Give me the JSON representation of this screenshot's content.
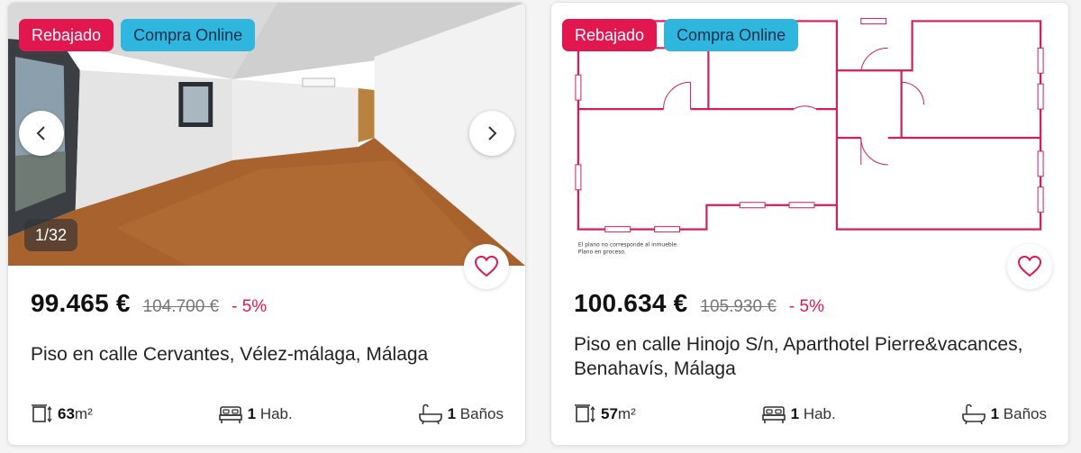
{
  "colors": {
    "accent": "#e3174f",
    "online": "#2fb6df"
  },
  "listings": [
    {
      "badges": {
        "discount_badge": "Rebajado",
        "online_badge": "Compra Online"
      },
      "gallery": {
        "counter": "1/32"
      },
      "price": "99.465 €",
      "old_price": "104.700 €",
      "discount": "- 5%",
      "title": "Piso en calle Cervantes, Vélez-málaga, Málaga",
      "features": {
        "area_value": "63",
        "area_unit": "m²",
        "rooms_value": "1",
        "rooms_label": "Hab.",
        "baths_value": "1",
        "baths_label": "Baños"
      },
      "icons": [
        "chevron-left-icon",
        "chevron-right-icon",
        "heart-icon",
        "area-icon",
        "bed-icon",
        "bathtub-icon"
      ]
    },
    {
      "badges": {
        "discount_badge": "Rebajado",
        "online_badge": "Compra Online"
      },
      "floorplan_note": [
        "El plano no corresponde al inmueble.",
        "Plano en proceso."
      ],
      "price": "100.634 €",
      "old_price": "105.930 €",
      "discount": "- 5%",
      "title": "Piso en calle Hinojo S/n, Aparthotel Pierre&vacances, Benahavís, Málaga",
      "features": {
        "area_value": "57",
        "area_unit": "m²",
        "rooms_value": "1",
        "rooms_label": "Hab.",
        "baths_value": "1",
        "baths_label": "Baños"
      },
      "icons": [
        "heart-icon",
        "area-icon",
        "bed-icon",
        "bathtub-icon"
      ]
    }
  ]
}
